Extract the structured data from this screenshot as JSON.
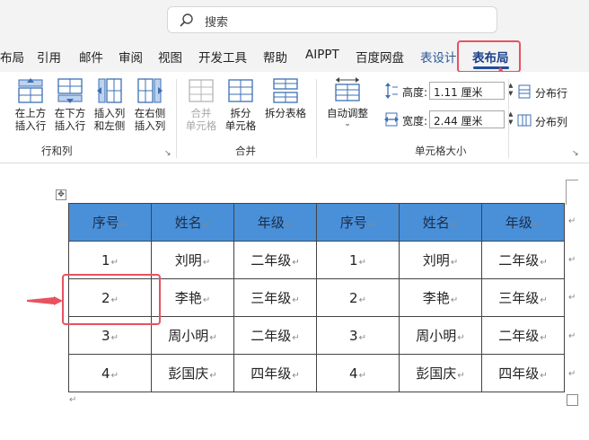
{
  "search": {
    "label": "搜索"
  },
  "tabs": [
    {
      "label": "布局"
    },
    {
      "label": "引用"
    },
    {
      "label": "邮件"
    },
    {
      "label": "审阅"
    },
    {
      "label": "视图"
    },
    {
      "label": "开发工具"
    },
    {
      "label": "帮助"
    },
    {
      "label": "AIPPT"
    },
    {
      "label": "百度网盘"
    },
    {
      "label": "表设计"
    },
    {
      "label": "表布局"
    }
  ],
  "ribbon": {
    "rows_cols": {
      "group_label": "行和列",
      "insert_above": "在上方\n插入行",
      "insert_below": "在下方\n插入行",
      "insert_left": "插入列\n和左侧",
      "insert_right": "在右侧\n插入列"
    },
    "merge": {
      "group_label": "合并",
      "merge_cells": "合并\n单元格",
      "split_cells": "拆分\n单元格",
      "split_table": "拆分表格"
    },
    "cell_size": {
      "group_label": "单元格大小",
      "autofit": "自动调整",
      "height_label": "高度:",
      "height_value": "1.11 厘米",
      "width_label": "宽度:",
      "width_value": "2.44 厘米",
      "distribute_rows": "分布行",
      "distribute_cols": "分布列"
    }
  },
  "table": {
    "headers": [
      "序号",
      "姓名",
      "年级",
      "序号",
      "姓名",
      "年级"
    ],
    "rows": [
      [
        "1",
        "刘明",
        "二年级",
        "1",
        "刘明",
        "二年级"
      ],
      [
        "2",
        "李艳",
        "三年级",
        "2",
        "李艳",
        "三年级"
      ],
      [
        "3",
        "周小明",
        "二年级",
        "3",
        "周小明",
        "二年级"
      ],
      [
        "4",
        "彭国庆",
        "四年级",
        "4",
        "彭国庆",
        "四年级"
      ]
    ]
  },
  "colors": {
    "accent": "#1f4e9c",
    "header_fill": "#4a90d9",
    "highlight": "#e8525f"
  }
}
